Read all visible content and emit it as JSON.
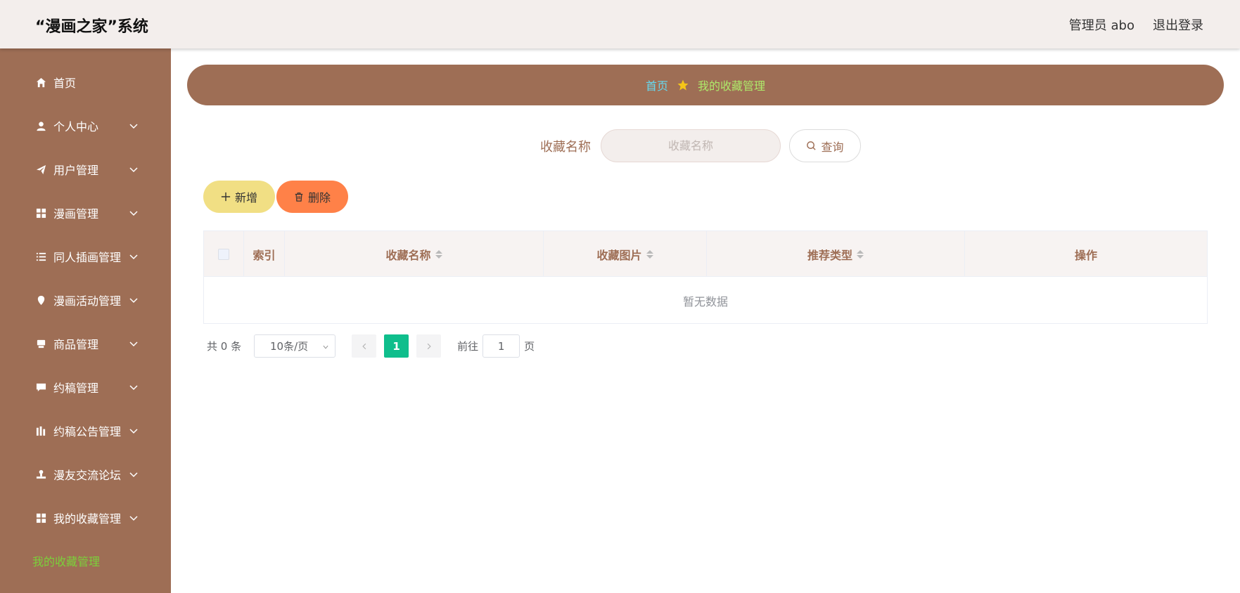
{
  "header": {
    "title": "“漫画之家”系统",
    "user": "管理员 abo",
    "logout": "退出登录"
  },
  "sidebar": {
    "items": [
      {
        "label": "首页",
        "icon": "home-icon"
      },
      {
        "label": "个人中心",
        "icon": "user-icon"
      },
      {
        "label": "用户管理",
        "icon": "send-icon"
      },
      {
        "label": "漫画管理",
        "icon": "grid-icon"
      },
      {
        "label": "同人插画管理",
        "icon": "list-icon"
      },
      {
        "label": "漫画活动管理",
        "icon": "location-icon"
      },
      {
        "label": "商品管理",
        "icon": "goods-icon"
      },
      {
        "label": "约稿管理",
        "icon": "chat-icon"
      },
      {
        "label": "约稿公告管理",
        "icon": "data-icon"
      },
      {
        "label": "漫友交流论坛",
        "icon": "stamp-icon"
      },
      {
        "label": "我的收藏管理",
        "icon": "grid-icon"
      }
    ],
    "active_sub": "我的收藏管理"
  },
  "breadcrumb": {
    "home": "首页",
    "current": "我的收藏管理"
  },
  "search": {
    "label": "收藏名称",
    "placeholder": "收藏名称",
    "button": "查询"
  },
  "actions": {
    "add": "新增",
    "delete": "删除"
  },
  "table": {
    "columns": [
      "索引",
      "收藏名称",
      "收藏图片",
      "推荐类型",
      "操作"
    ],
    "empty_text": "暂无数据"
  },
  "pagination": {
    "total": "共 0 条",
    "page_size": "10条/页",
    "current_page": "1",
    "goto_label": "前往",
    "goto_value": "1",
    "page_suffix": "页"
  },
  "colors": {
    "brand": "#9e6e55",
    "active_green": "#7bd13a",
    "page_accent": "#0fbe8c",
    "add_button": "#f1df84",
    "delete_button": "#ff8148"
  }
}
